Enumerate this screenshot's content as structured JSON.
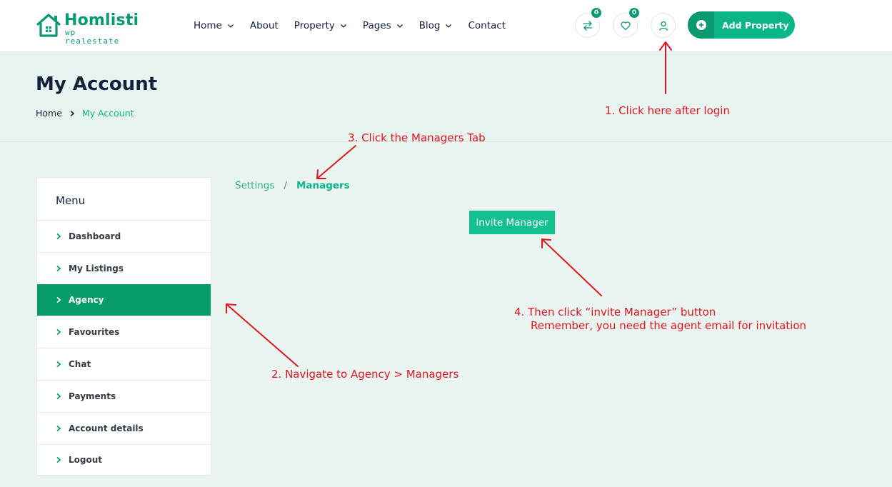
{
  "brand": {
    "name": "Homlisti",
    "tagline": "wp realestate",
    "color": "#0a9a73"
  },
  "nav": {
    "items": [
      {
        "label": "Home",
        "has_dropdown": true
      },
      {
        "label": "About",
        "has_dropdown": false
      },
      {
        "label": "Property",
        "has_dropdown": true
      },
      {
        "label": "Pages",
        "has_dropdown": true
      },
      {
        "label": "Blog",
        "has_dropdown": true
      },
      {
        "label": "Contact",
        "has_dropdown": false
      }
    ]
  },
  "header_actions": {
    "compare_count": "0",
    "favourites_count": "0",
    "compare_icon": "compare-arrows-icon",
    "favourites_icon": "heart-icon",
    "account_icon": "user-icon",
    "add_property_label": "Add Property",
    "accent": "#0bb587"
  },
  "page": {
    "title": "My Account",
    "breadcrumb_home": "Home",
    "breadcrumb_current": "My Account"
  },
  "sidebar": {
    "title": "Menu",
    "items": [
      {
        "label": "Dashboard",
        "active": false
      },
      {
        "label": "My Listings",
        "active": false
      },
      {
        "label": "Agency",
        "active": true
      },
      {
        "label": "Favourites",
        "active": false
      },
      {
        "label": "Chat",
        "active": false
      },
      {
        "label": "Payments",
        "active": false
      },
      {
        "label": "Account details",
        "active": false
      },
      {
        "label": "Logout",
        "active": false
      }
    ],
    "active_color": "#089c6d"
  },
  "content": {
    "tab_settings": "Settings",
    "tab_separator": "/",
    "tab_managers": "Managers",
    "invite_button": "Invite Manager"
  },
  "annotations": {
    "color": "#e3141e",
    "step1": "1. Click here after login",
    "step2": "2. Navigate to Agency > Managers",
    "step3": "3. Click the Managers Tab",
    "step4_line1": "4. Then click “invite Manager” button",
    "step4_line2": "Remember, you need the agent email for invitation"
  }
}
